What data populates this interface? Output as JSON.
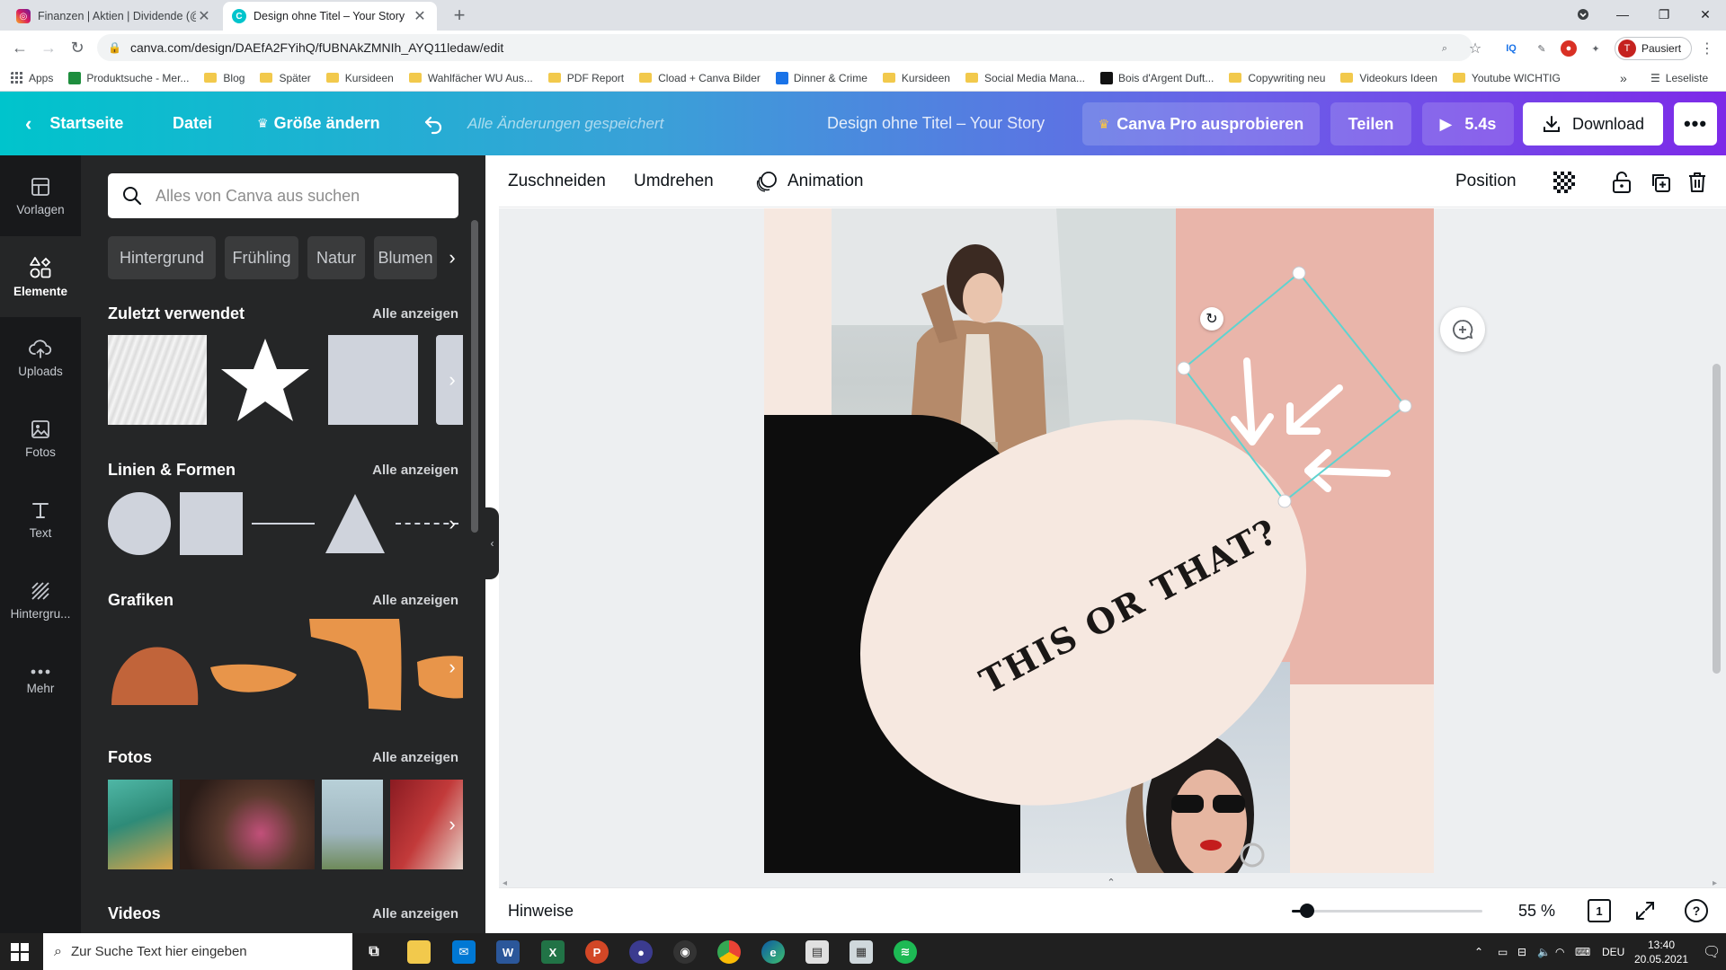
{
  "browser": {
    "tabs": [
      {
        "title": "Finanzen | Aktien | Dividende (@"
      },
      {
        "title": "Design ohne Titel – Your Story"
      }
    ],
    "new_tab": "+",
    "url": "canva.com/design/DAEfA2FYihQ/fUBNAkZMNIh_AYQ11ledaw/edit",
    "profile_initial": "T",
    "profile_label": "Pausiert",
    "bookmarks": [
      "Apps",
      "Produktsuche - Mer...",
      "Blog",
      "Später",
      "Kursideen",
      "Wahlfächer WU Aus...",
      "PDF Report",
      "Cload + Canva Bilder",
      "Dinner & Crime",
      "Kursideen",
      "Social Media Mana...",
      "Bois d'Argent Duft...",
      "Copywriting neu",
      "Videokurs Ideen",
      "Youtube WICHTIG"
    ],
    "bookmark_more": "»",
    "reading_list": "Leseliste"
  },
  "header": {
    "home": "Startseite",
    "file": "Datei",
    "resize": "Größe ändern",
    "saved": "Alle Änderungen gespeichert",
    "title": "Design ohne Titel – Your Story",
    "pro": "Canva Pro ausprobieren",
    "share": "Teilen",
    "play": "5.4s",
    "download": "Download",
    "more": "•••"
  },
  "rail": [
    {
      "label": "Vorlagen"
    },
    {
      "label": "Elemente"
    },
    {
      "label": "Uploads"
    },
    {
      "label": "Fotos"
    },
    {
      "label": "Text"
    },
    {
      "label": "Hintergru..."
    },
    {
      "label": "Mehr"
    }
  ],
  "panel": {
    "search_placeholder": "Alles von Canva aus suchen",
    "chips": [
      "Hintergrund",
      "Frühling",
      "Natur",
      "Blumen"
    ],
    "sections": [
      {
        "title": "Zuletzt verwendet",
        "all": "Alle anzeigen"
      },
      {
        "title": "Linien & Formen",
        "all": "Alle anzeigen"
      },
      {
        "title": "Grafiken",
        "all": "Alle anzeigen"
      },
      {
        "title": "Fotos",
        "all": "Alle anzeigen"
      },
      {
        "title": "Videos",
        "all": "Alle anzeigen"
      }
    ]
  },
  "toolbar": {
    "crop": "Zuschneiden",
    "flip": "Umdrehen",
    "animation": "Animation",
    "position": "Position"
  },
  "design": {
    "headline": "THIS OR THAT?"
  },
  "bottom": {
    "notes": "Hinweise",
    "zoom": "55 %",
    "zoom_fraction": 0.08,
    "page_count": "1"
  },
  "taskbar": {
    "search_placeholder": "Zur Suche Text hier eingeben",
    "lang": "DEU",
    "time": "13:40",
    "date": "20.05.2021"
  },
  "colors": {
    "accent_teal": "#00c4cc",
    "accent_purple": "#7d2ae8",
    "selection": "#5fd3d0",
    "panel_bg": "#252627",
    "rail_bg": "#18191b",
    "shape_orange": "#e8954a",
    "shape_brown": "#c1643a",
    "shape_gray": "#cfd3dc"
  }
}
